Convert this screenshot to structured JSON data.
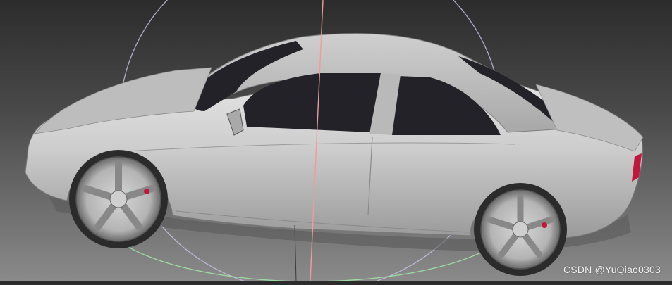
{
  "watermark": {
    "text": "CSDN @YuQiao0303"
  },
  "viewport": {
    "background_top": "#2c2c2c",
    "background_bottom": "#8a8a8a",
    "gizmo": {
      "ring_xy_color": "#c6c2e6",
      "ring_xz_color": "#9fe8a4",
      "axis_vertical_color": "#ee9c9c"
    },
    "model": {
      "body_color": "#c9c9c9",
      "glass_color": "#232229",
      "tail_light_color": "#c2163a"
    }
  }
}
